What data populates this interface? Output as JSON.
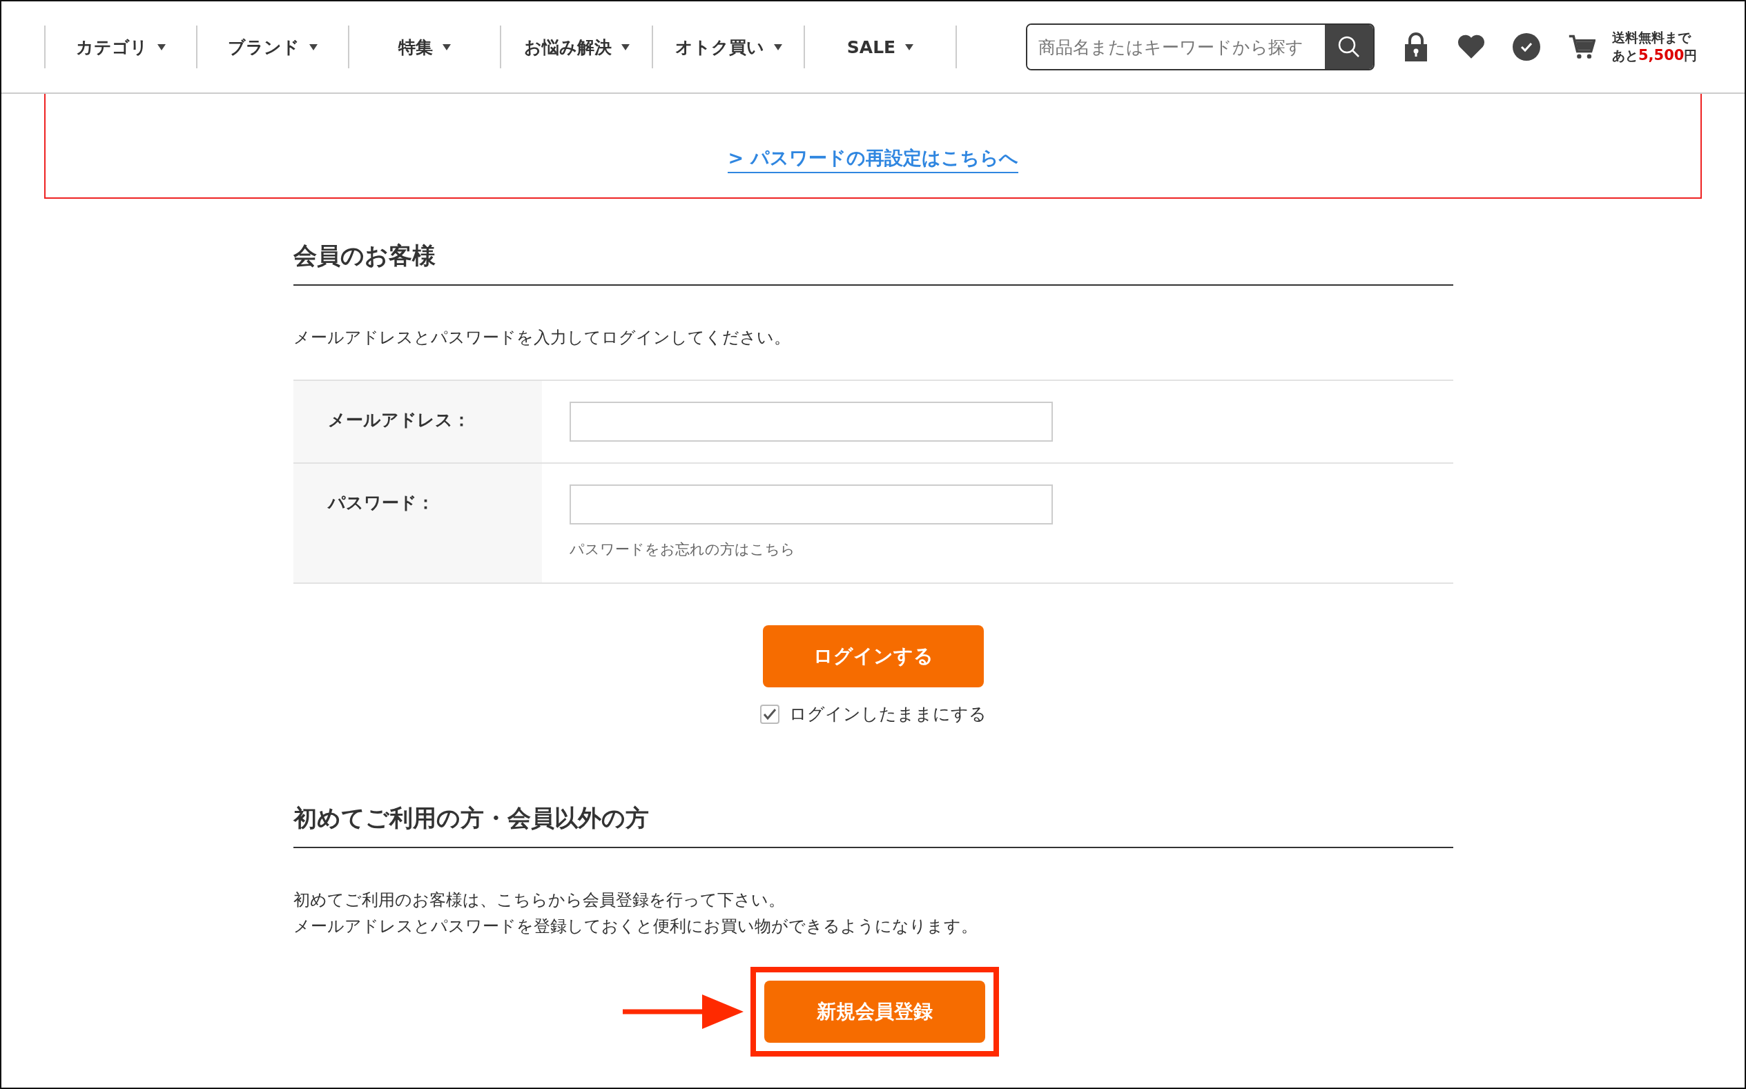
{
  "nav": {
    "items": [
      {
        "label": "カテゴリ"
      },
      {
        "label": "ブランド"
      },
      {
        "label": "特集"
      },
      {
        "label": "お悩み解決"
      },
      {
        "label": "オトク買い"
      },
      {
        "label": "SALE"
      }
    ]
  },
  "search": {
    "placeholder": "商品名またはキーワードから探す"
  },
  "shipping": {
    "line1": "送料無料まで",
    "prefix": "あと",
    "amount": "5,500",
    "suffix": "円"
  },
  "notice": {
    "link": "> パスワードの再設定はこちらへ"
  },
  "member": {
    "heading": "会員のお客様",
    "description": "メールアドレスとパスワードを入力してログインしてください。",
    "fields": [
      {
        "label": "メールアドレス："
      },
      {
        "label": "パスワード：",
        "help_link": "パスワードをお忘れの方はこちら"
      }
    ],
    "login_button": "ログインする",
    "remember": {
      "label": "ログインしたままにする",
      "checked": true
    }
  },
  "guest": {
    "heading": "初めてご利用の方・会員以外の方",
    "lines": [
      "初めてご利用のお客様は、こちらから会員登録を行って下さい。",
      "メールアドレスとパスワードを登録しておくと便利にお買い物ができるようになります。"
    ],
    "register_button": "新規会員登録"
  }
}
